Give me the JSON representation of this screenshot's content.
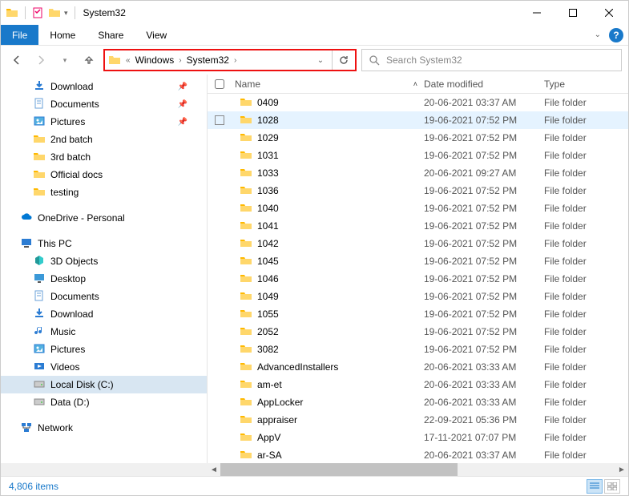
{
  "titleBar": {
    "title": "System32"
  },
  "ribbon": {
    "file": "File",
    "tabs": [
      "Home",
      "Share",
      "View"
    ]
  },
  "address": {
    "prefix": "«",
    "segments": [
      "Windows",
      "System32"
    ]
  },
  "search": {
    "placeholder": "Search System32"
  },
  "navTree": {
    "quick": [
      {
        "label": "Download",
        "icon": "download",
        "pinned": true
      },
      {
        "label": "Documents",
        "icon": "documents",
        "pinned": true
      },
      {
        "label": "Pictures",
        "icon": "pictures",
        "pinned": true
      },
      {
        "label": "2nd batch",
        "icon": "folder"
      },
      {
        "label": "3rd batch",
        "icon": "folder"
      },
      {
        "label": "Official docs",
        "icon": "folder"
      },
      {
        "label": "testing",
        "icon": "folder"
      }
    ],
    "onedrive": {
      "label": "OneDrive - Personal",
      "icon": "onedrive"
    },
    "thispc": {
      "label": "This PC",
      "children": [
        {
          "label": "3D Objects",
          "icon": "3dobjects"
        },
        {
          "label": "Desktop",
          "icon": "desktop"
        },
        {
          "label": "Documents",
          "icon": "documents"
        },
        {
          "label": "Download",
          "icon": "download"
        },
        {
          "label": "Music",
          "icon": "music"
        },
        {
          "label": "Pictures",
          "icon": "pictures"
        },
        {
          "label": "Videos",
          "icon": "videos"
        },
        {
          "label": "Local Disk (C:)",
          "icon": "disk",
          "selected": true
        },
        {
          "label": "Data (D:)",
          "icon": "disk"
        }
      ]
    },
    "network": {
      "label": "Network",
      "icon": "network"
    }
  },
  "columns": {
    "name": "Name",
    "date": "Date modified",
    "type": "Type"
  },
  "files": [
    {
      "name": "0409",
      "date": "20-06-2021 03:37 AM",
      "type": "File folder"
    },
    {
      "name": "1028",
      "date": "19-06-2021 07:52 PM",
      "type": "File folder",
      "hover": true
    },
    {
      "name": "1029",
      "date": "19-06-2021 07:52 PM",
      "type": "File folder"
    },
    {
      "name": "1031",
      "date": "19-06-2021 07:52 PM",
      "type": "File folder"
    },
    {
      "name": "1033",
      "date": "20-06-2021 09:27 AM",
      "type": "File folder"
    },
    {
      "name": "1036",
      "date": "19-06-2021 07:52 PM",
      "type": "File folder"
    },
    {
      "name": "1040",
      "date": "19-06-2021 07:52 PM",
      "type": "File folder"
    },
    {
      "name": "1041",
      "date": "19-06-2021 07:52 PM",
      "type": "File folder"
    },
    {
      "name": "1042",
      "date": "19-06-2021 07:52 PM",
      "type": "File folder"
    },
    {
      "name": "1045",
      "date": "19-06-2021 07:52 PM",
      "type": "File folder"
    },
    {
      "name": "1046",
      "date": "19-06-2021 07:52 PM",
      "type": "File folder"
    },
    {
      "name": "1049",
      "date": "19-06-2021 07:52 PM",
      "type": "File folder"
    },
    {
      "name": "1055",
      "date": "19-06-2021 07:52 PM",
      "type": "File folder"
    },
    {
      "name": "2052",
      "date": "19-06-2021 07:52 PM",
      "type": "File folder"
    },
    {
      "name": "3082",
      "date": "19-06-2021 07:52 PM",
      "type": "File folder"
    },
    {
      "name": "AdvancedInstallers",
      "date": "20-06-2021 03:33 AM",
      "type": "File folder"
    },
    {
      "name": "am-et",
      "date": "20-06-2021 03:33 AM",
      "type": "File folder"
    },
    {
      "name": "AppLocker",
      "date": "20-06-2021 03:33 AM",
      "type": "File folder"
    },
    {
      "name": "appraiser",
      "date": "22-09-2021 05:36 PM",
      "type": "File folder"
    },
    {
      "name": "AppV",
      "date": "17-11-2021 07:07 PM",
      "type": "File folder"
    },
    {
      "name": "ar-SA",
      "date": "20-06-2021 03:37 AM",
      "type": "File folder"
    }
  ],
  "status": {
    "count": "4,806 items"
  }
}
